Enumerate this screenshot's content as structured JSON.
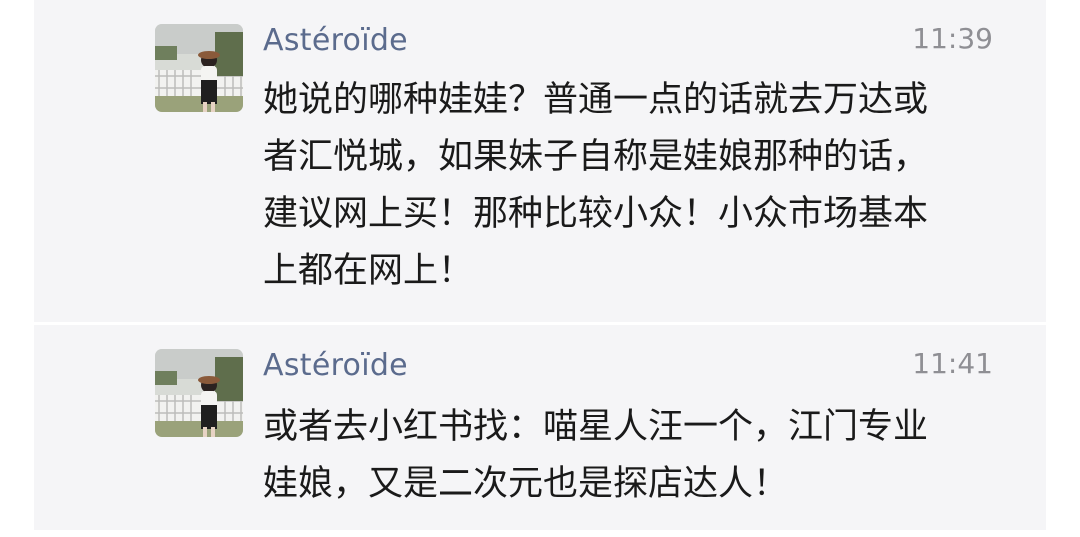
{
  "messages": [
    {
      "sender": "Astéroïde",
      "time": "11:39",
      "lines": [
        "她说的哪种娃娃？普通一点的话就去万达或",
        "者汇悦城，如果妹子自称是娃娘那种的话，",
        "建议网上买！那种比较小众！小众市场基本",
        "上都在网上！"
      ]
    },
    {
      "sender": "Astéroïde",
      "time": "11:41",
      "lines": [
        "或者去小红书找：喵星人汪一个，江门专业",
        "娃娘，又是二次元也是探店达人！"
      ]
    }
  ],
  "icons": {
    "comment": "comment-icon",
    "avatar": "avatar-photo"
  },
  "colors": {
    "sender": "#5b6b8d",
    "time": "#8f8f94",
    "card_bg": "#f5f5f7",
    "text": "#1a1a1a"
  }
}
